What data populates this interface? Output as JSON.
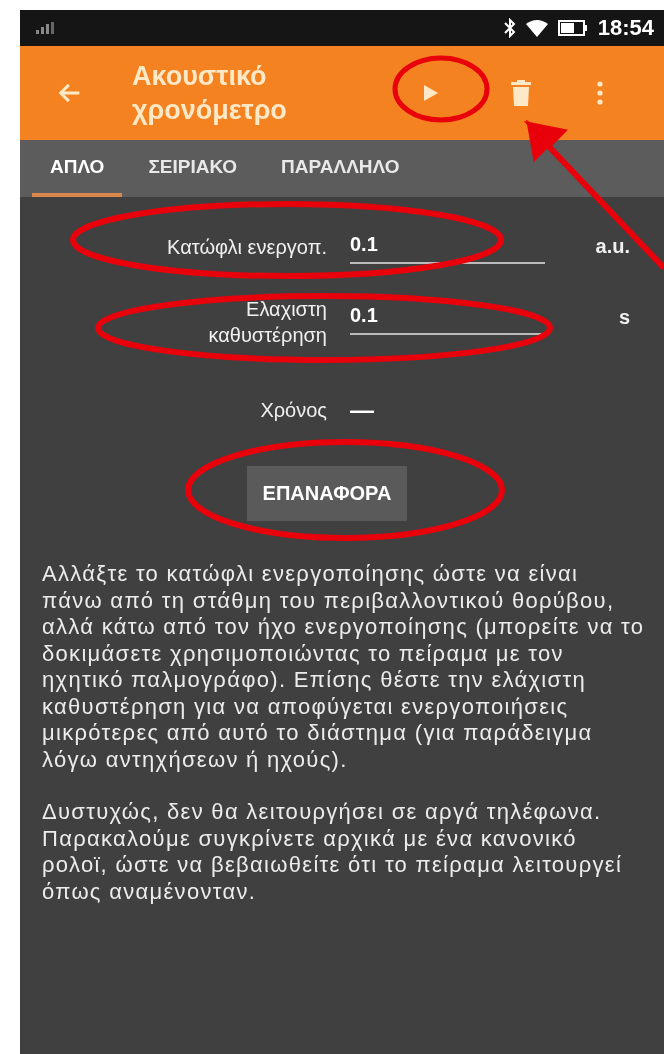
{
  "status_bar": {
    "time": "18:54"
  },
  "app_bar": {
    "title": "Ακουστικό χρονόμετρο"
  },
  "tabs": [
    {
      "label": "ΑΠΛΟ",
      "selected": true
    },
    {
      "label": "ΣΕΙΡΙΑΚΟ",
      "selected": false
    },
    {
      "label": "ΠΑΡΑΛΛΗΛΟ",
      "selected": false
    }
  ],
  "fields": [
    {
      "label": "Κατώφλι ενεργοπ.",
      "value": "0.1",
      "unit": "a.u."
    },
    {
      "label": "Ελαχιστη καθυστέρηση",
      "value": "0.1",
      "unit": "s"
    }
  ],
  "result": {
    "label": "Χρόνος",
    "value": "—"
  },
  "reset_button": "ΕΠΑΝΑΦΟΡΑ",
  "help_paragraphs": [
    "Αλλάξτε το κατώφλι ενεργοποίησης ώστε να είναι πάνω από τη στάθμη του περιβαλλοντικού θορύβου, αλλά κάτω από τον ήχο ενεργοποίησης (μπορείτε να το δοκιμάσετε χρησιμοποιώντας το πείραμα με τον ηχητικό παλμογράφο). Επίσης θέστε την ελάχιστη καθυστέρηση για να αποφύγεται ενεργοποιήσεις μικρότερες από αυτό το διάστημα (για παράδειγμα λόγω αντηχήσεων ή ηχούς).",
    "Δυστυχώς, δεν θα λειτουργήσει σε αργά τηλέφωνα. Παρακαλούμε συγκρίνετε αρχικά με ένα κανονικό ρολοϊ, ώστε να βεβαιωθείτε ότι το πείραμα λειτουργεί όπως αναμένονταν."
  ]
}
